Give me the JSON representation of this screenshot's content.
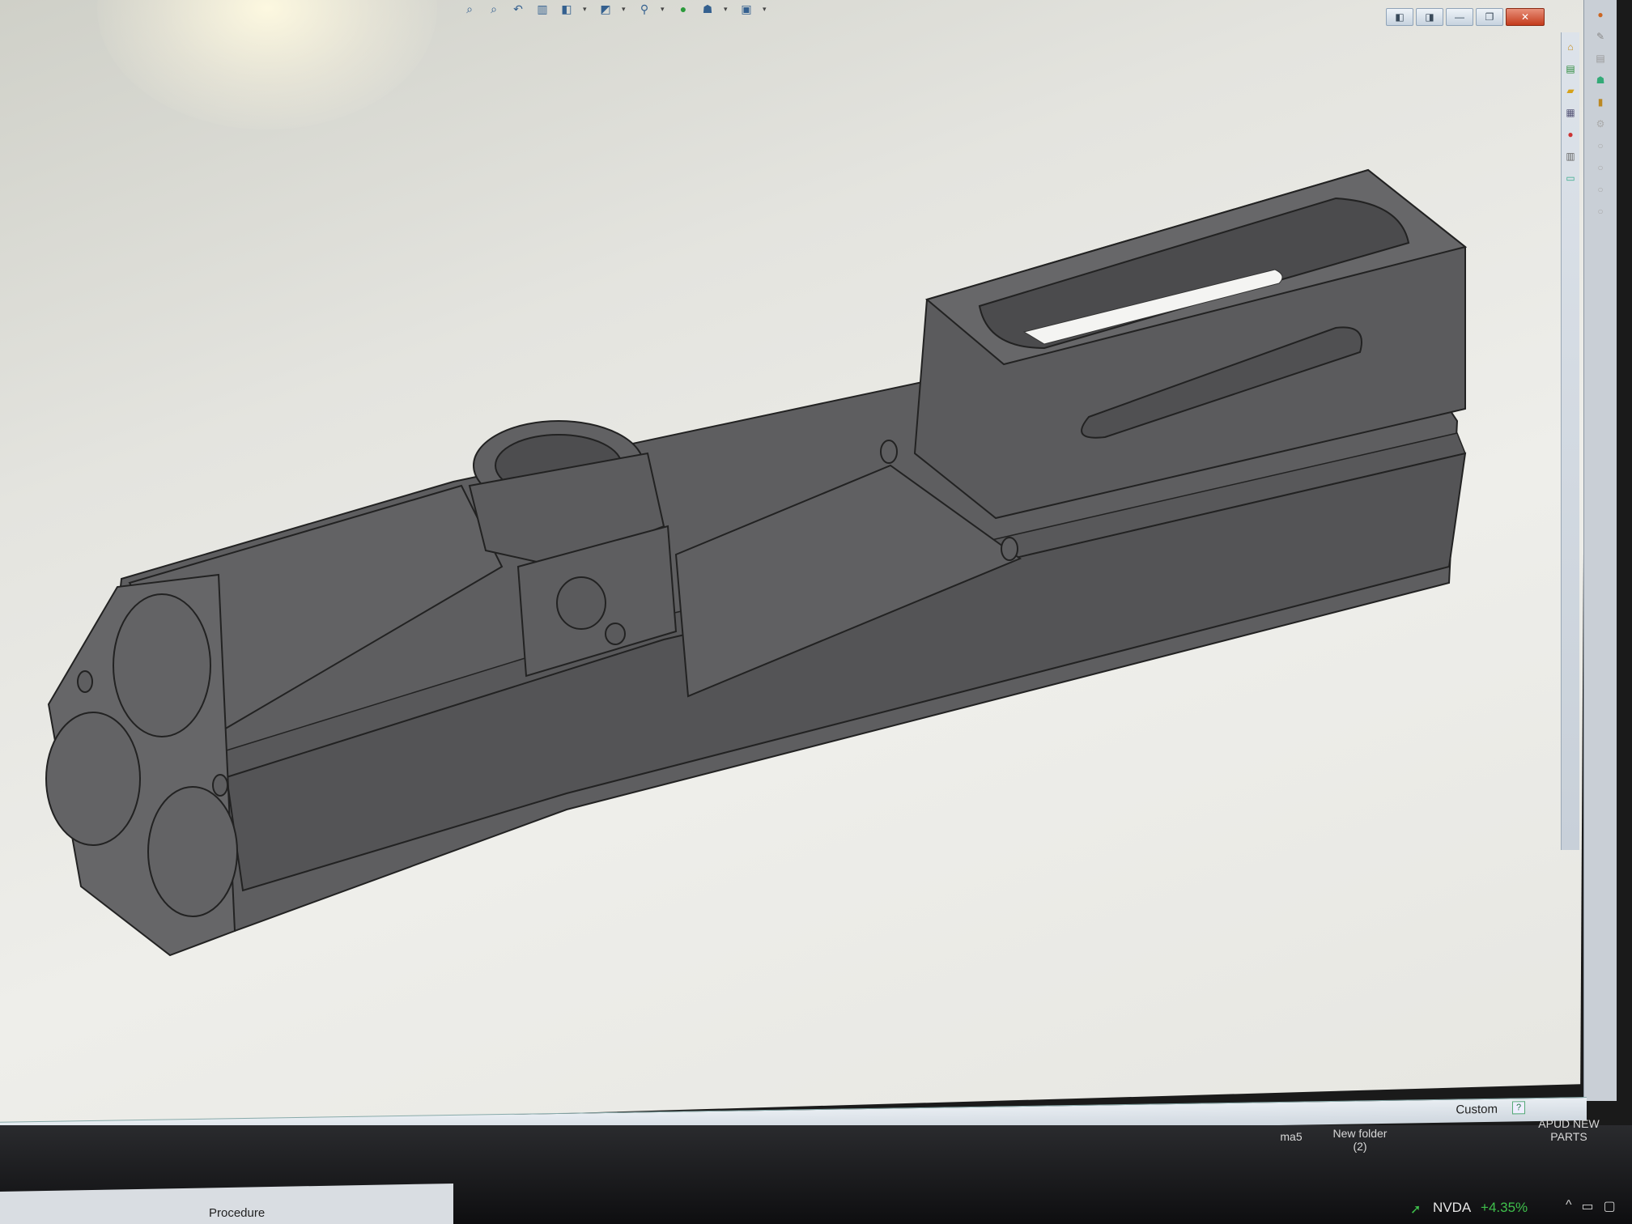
{
  "toolbar": {
    "icons": [
      "zoom-to-fit-icon",
      "zoom-area-icon",
      "previous-view-icon",
      "section-view-icon",
      "view-orientation-icon",
      "display-style-icon",
      "hide-show-items-icon",
      "edit-appearance-icon",
      "apply-scene-icon",
      "view-settings-icon"
    ]
  },
  "window_controls": {
    "min": "—",
    "restore": "❐",
    "close": "✕"
  },
  "status": {
    "unit_system": "Custom",
    "help": "?"
  },
  "desktop": {
    "items": [
      "ma5",
      "New folder\n(2)",
      "APUD NEW\nPARTS"
    ]
  },
  "taskbar": {
    "ticker_symbol": "NVDA",
    "ticker_change": "+4.35%",
    "bottom_label": "Procedure"
  },
  "colors": {
    "model_fill": "#5f5f61",
    "viewport_bg": "#e8e8e4"
  }
}
